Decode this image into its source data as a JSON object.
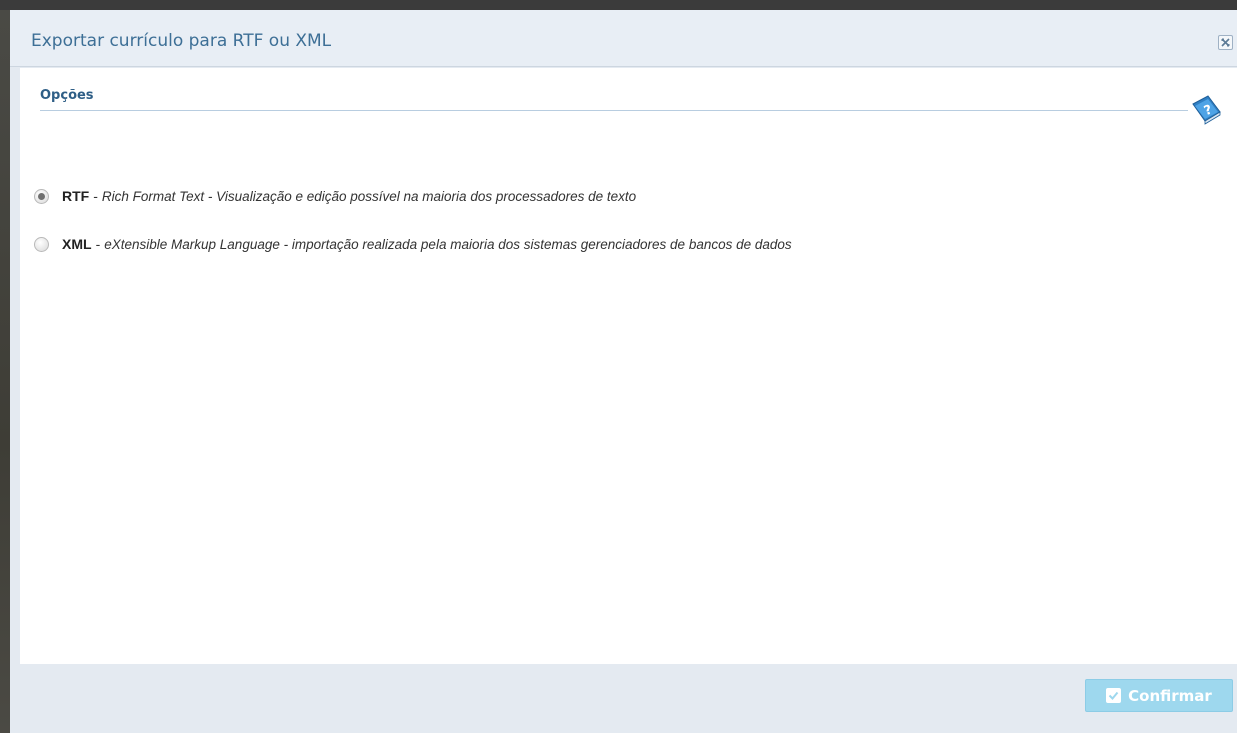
{
  "dialog": {
    "title": "Exportar currículo para RTF ou XML",
    "close_icon": "close-icon"
  },
  "section": {
    "title": "Opções",
    "help_icon": "help-book-icon"
  },
  "options": [
    {
      "code": "RTF",
      "separator": "-",
      "description": "Rich Format Text - Visualização e edição possível na maioria dos processadores de texto",
      "selected": true
    },
    {
      "code": "XML",
      "separator": "-",
      "description": "eXtensible Markup Language - importação realizada pela maioria dos sistemas gerenciadores de bancos de dados",
      "selected": false
    }
  ],
  "footer": {
    "confirm_label": "Confirmar",
    "confirm_icon": "check-icon"
  },
  "colors": {
    "title_text": "#3d6f96",
    "section_text": "#2e5e86",
    "confirm_button": "#9ed8ee",
    "dialog_frame": "#e4eaf1"
  }
}
